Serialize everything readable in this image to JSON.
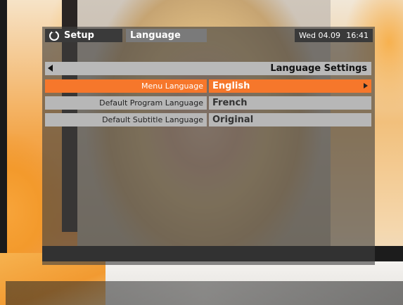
{
  "header": {
    "setup_label": "Setup",
    "current_menu": "Language",
    "date": "Wed 04.09",
    "time": "16:41"
  },
  "section": {
    "title": "Language Settings"
  },
  "settings": [
    {
      "label": "Menu Language",
      "value": "English",
      "selected": true
    },
    {
      "label": "Default Program Language",
      "value": "French",
      "selected": false
    },
    {
      "label": "Default Subtitle Language",
      "value": "Original",
      "selected": false
    }
  ],
  "colors": {
    "accent": "#f6772b",
    "row_bg": "#b7b7b7",
    "header_bg": "#3a3a3a",
    "active_tab_bg": "#7a7a7a"
  },
  "icons": {
    "setup": "ring-icon",
    "back": "left-triangle-icon",
    "next": "right-triangle-icon"
  }
}
